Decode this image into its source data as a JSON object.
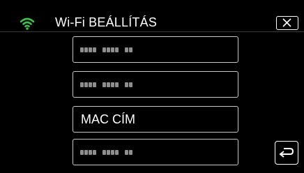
{
  "header": {
    "title": "Wi-Fi BEÁLLÍTÁS",
    "wifi_icon": "wifi-icon",
    "close_icon": "close-icon",
    "accent_color": "#3cc24a"
  },
  "menu": {
    "items": [
      {
        "label": "",
        "masked": true
      },
      {
        "label": "",
        "masked": true
      },
      {
        "label": "MAC CÍM",
        "masked": false
      },
      {
        "label": "",
        "masked": true
      }
    ]
  },
  "footer": {
    "back_icon": "back-return-icon"
  }
}
